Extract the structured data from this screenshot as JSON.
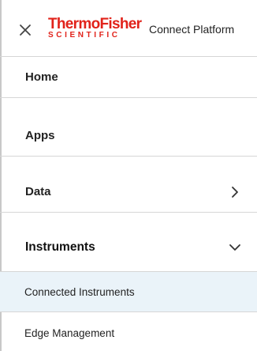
{
  "header": {
    "close_icon": "close-icon",
    "brand": {
      "line1": "ThermoFisher",
      "line2": "SCIENTIFIC",
      "color": "#e1221a"
    },
    "platform_name": "Connect Platform"
  },
  "nav": {
    "items": [
      {
        "label": "Home"
      },
      {
        "label": "Apps"
      },
      {
        "label": "Data",
        "icon": "chevron-right-icon"
      },
      {
        "label": "Instruments",
        "icon": "chevron-down-icon",
        "expanded": true
      }
    ],
    "sub_items": [
      {
        "label": "Connected Instruments",
        "active": true
      },
      {
        "label": "Edge Management",
        "active": false
      }
    ]
  },
  "colors": {
    "active_bg": "#eaf3f9",
    "divider": "#d6d6d6",
    "text": "#222222"
  }
}
